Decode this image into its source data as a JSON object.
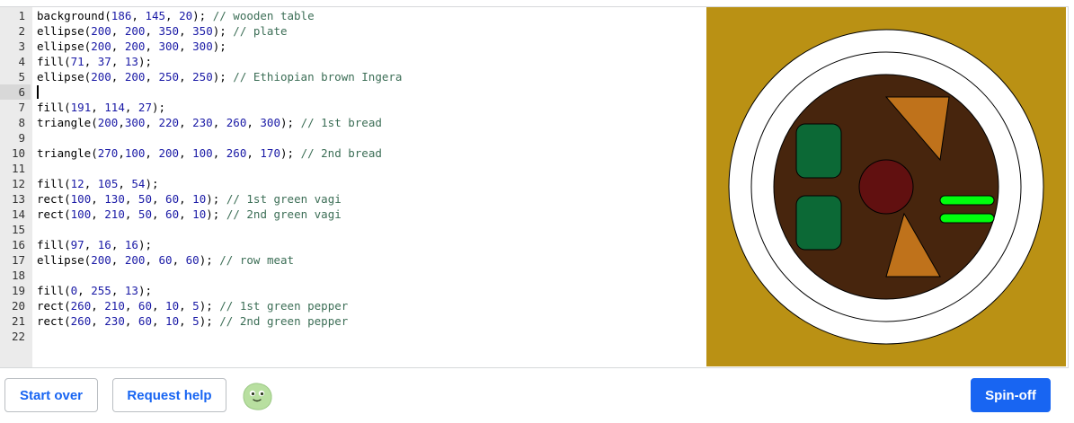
{
  "editor": {
    "cursor_line": 6,
    "lines": [
      {
        "n": "1",
        "code": "background(186, 145, 20); // wooden table"
      },
      {
        "n": "2",
        "code": "ellipse(200, 200, 350, 350); // plate"
      },
      {
        "n": "3",
        "code": "ellipse(200, 200, 300, 300);"
      },
      {
        "n": "4",
        "code": "fill(71, 37, 13);"
      },
      {
        "n": "5",
        "code": "ellipse(200, 200, 250, 250); // Ethiopian brown Ingera"
      },
      {
        "n": "6",
        "code": ""
      },
      {
        "n": "7",
        "code": "fill(191, 114, 27);"
      },
      {
        "n": "8",
        "code": "triangle(200,300, 220, 230, 260, 300); // 1st bread"
      },
      {
        "n": "9",
        "code": ""
      },
      {
        "n": "10",
        "code": "triangle(270,100, 200, 100, 260, 170); // 2nd bread"
      },
      {
        "n": "11",
        "code": ""
      },
      {
        "n": "12",
        "code": "fill(12, 105, 54);"
      },
      {
        "n": "13",
        "code": "rect(100, 130, 50, 60, 10); // 1st green vagi"
      },
      {
        "n": "14",
        "code": "rect(100, 210, 50, 60, 10); // 2nd green vagi"
      },
      {
        "n": "15",
        "code": ""
      },
      {
        "n": "16",
        "code": "fill(97, 16, 16);"
      },
      {
        "n": "17",
        "code": "ellipse(200, 200, 60, 60); // row meat"
      },
      {
        "n": "18",
        "code": ""
      },
      {
        "n": "19",
        "code": "fill(0, 255, 13);"
      },
      {
        "n": "20",
        "code": "rect(260, 210, 60, 10, 5); // 1st green pepper"
      },
      {
        "n": "21",
        "code": "rect(260, 230, 60, 10, 5); // 2nd green pepper"
      },
      {
        "n": "22",
        "code": ""
      }
    ]
  },
  "canvas": {
    "background": "#ba9114",
    "plate_color": "#ffffff",
    "ingera_color": "#47250d",
    "bread_color": "#bf721b",
    "vegetable_color": "#0c6936",
    "meat_color": "#611010",
    "pepper_color": "#00ff0d"
  },
  "footer": {
    "start_over_label": "Start over",
    "request_help_label": "Request help",
    "spin_off_label": "Spin-off",
    "accent_color": "#1865f2",
    "avatar_icon": "green-blob-avatar-icon"
  }
}
